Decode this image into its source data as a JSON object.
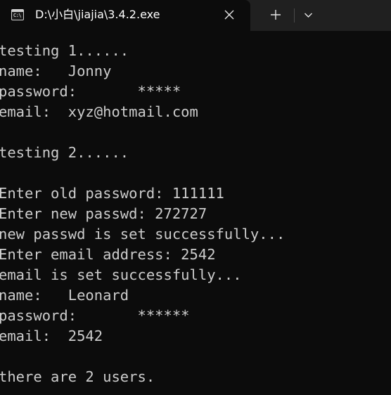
{
  "window": {
    "tab_title": "D:\\小白\\jiajia\\3.4.2.exe",
    "tab_icon_text": "C:\\",
    "icons": {
      "tab": "terminal-icon",
      "close": "close-icon",
      "new_tab": "plus-icon",
      "dropdown": "chevron-down-icon"
    }
  },
  "colors": {
    "background": "#0c0c0c",
    "tabbar": "#202020",
    "text": "#cccccc"
  },
  "console": {
    "lines": [
      "testing 1......",
      "name:   Jonny",
      "password:       *****",
      "email:  xyz@hotmail.com",
      "",
      "testing 2......",
      "",
      "Enter old password: 111111",
      "Enter new passwd: 272727",
      "new passwd is set successfully...",
      "Enter email address: 2542",
      "email is set successfully...",
      "name:   Leonard",
      "password:       ******",
      "email:  2542",
      "",
      "there are 2 users."
    ]
  }
}
